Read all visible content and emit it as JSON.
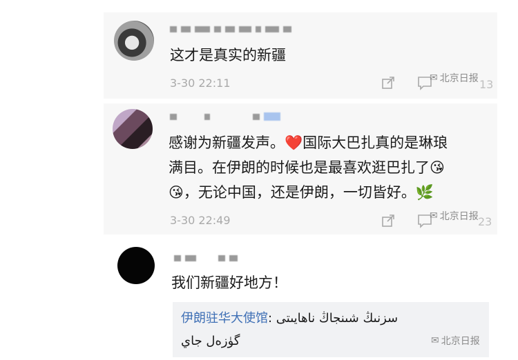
{
  "comments": [
    {
      "text": "这才是真实的新疆",
      "time": "3-30 22:11",
      "likes": "13"
    },
    {
      "text_lines": [
        "感谢为新疆发声。❤️国际大巴扎真的是琳琅",
        "满目。在伊朗的时候也是最喜欢逛巴扎了😘",
        "😘，无论中国，还是伊朗，一切皆好。🌿"
      ],
      "time": "3-30 22:49",
      "likes": "23"
    },
    {
      "text": "我们新疆好地方！",
      "reply": {
        "author": "伊朗驻华大使馆",
        "separator": ": ",
        "text_line1": "سزنىڭ شىنجاڭ ناھايىتى",
        "text_line2": "گۈزەل جاي"
      }
    }
  ],
  "watermark": "北京日报",
  "icons": {
    "share": "share-icon",
    "comment": "comment-icon",
    "watermark_logo": "bubble-logo-icon"
  }
}
